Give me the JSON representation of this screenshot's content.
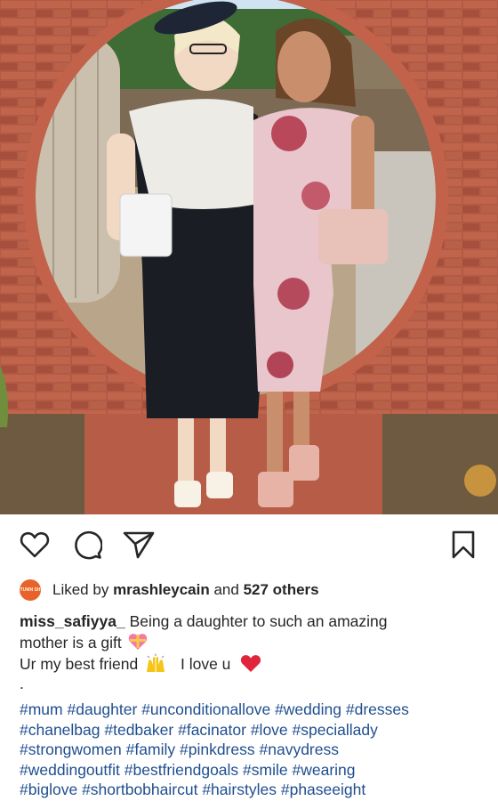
{
  "post": {
    "photo_alt": "Two women posing in front of a circular brick archway",
    "actions": {
      "like_icon": "heart-icon",
      "comment_icon": "comment-icon",
      "share_icon": "send-icon",
      "save_icon": "bookmark-icon"
    },
    "likes": {
      "avatar_text": "AUTUMN SHOP",
      "prefix": "Liked by ",
      "user": "mrashleycain",
      "middle": " and ",
      "count_text": "527 others"
    },
    "caption": {
      "username": "miss_safiyya_",
      "line1_text": " Being a daughter to such an amazing",
      "line2_text": "mother is a gift",
      "line3_text_a": "Ur my best friend",
      "line3_text_b": "I love u",
      "separator": "."
    },
    "hashtag_lines": [
      [
        "#mum",
        "#daughter",
        "#unconditionallove",
        "#wedding",
        "#dresses"
      ],
      [
        "#chanelbag",
        "#tedbaker",
        "#facinator",
        "#love",
        "#speciallady"
      ],
      [
        "#strongwomen",
        "#family",
        "#pinkdress",
        "#navydress"
      ],
      [
        "#weddingoutfit",
        "#bestfriendgoals",
        "#smile",
        "#wearing"
      ],
      [
        "#biglove",
        "#shortbobhaircut",
        "#hairstyles",
        "#phaseeight"
      ]
    ],
    "colors": {
      "text": "#262626",
      "hashtag": "#1f4e8f",
      "avatar_bg": "#e8632b",
      "heart_emoji": "#e0243a"
    }
  }
}
